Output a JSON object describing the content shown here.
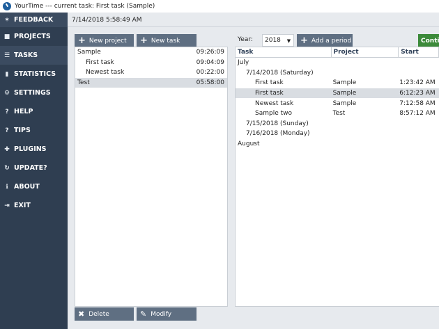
{
  "window": {
    "title": "YourTime --- current task: First task (Sample)"
  },
  "sidebar": {
    "items": [
      {
        "label": "FEEDBACK",
        "icon": "star-icon"
      },
      {
        "label": "PROJECTS",
        "icon": "folder-icon"
      },
      {
        "label": "TASKS",
        "icon": "list-icon"
      },
      {
        "label": "STATISTICS",
        "icon": "bar-chart-icon"
      },
      {
        "label": "SETTINGS",
        "icon": "gear-icon"
      },
      {
        "label": "HELP",
        "icon": "question-icon"
      },
      {
        "label": "TIPS",
        "icon": "question-icon"
      },
      {
        "label": "PLUGINS",
        "icon": "puzzle-icon"
      },
      {
        "label": "UPDATE?",
        "icon": "refresh-icon"
      },
      {
        "label": "ABOUT",
        "icon": "info-icon"
      },
      {
        "label": "EXIT",
        "icon": "exit-icon"
      }
    ]
  },
  "header": {
    "datetime": "7/14/2018 5:58:49 AM"
  },
  "toolbar": {
    "new_project": "New project",
    "new_task": "New task",
    "year_label": "Year:",
    "year_value": "2018",
    "add_period": "Add a period",
    "continue": "Continue"
  },
  "projects": [
    {
      "name": "Sample",
      "time": "09:26:09",
      "level": 0
    },
    {
      "name": "First task",
      "time": "09:04:09",
      "level": 1
    },
    {
      "name": "Newest task",
      "time": "00:22:00",
      "level": 1
    },
    {
      "name": "Test",
      "time": "05:58:00",
      "level": 0
    }
  ],
  "grid": {
    "columns": {
      "task": "Task",
      "project": "Project",
      "start": "Start"
    },
    "rows": [
      {
        "task": "July",
        "project": "",
        "start": "",
        "level": 0
      },
      {
        "task": "7/14/2018 (Saturday)",
        "project": "",
        "start": "",
        "level": 1
      },
      {
        "task": "First task",
        "project": "Sample",
        "start": "1:23:42 AM",
        "level": 2
      },
      {
        "task": "First task",
        "project": "Sample",
        "start": "6:12:23 AM",
        "level": 2
      },
      {
        "task": "Newest task",
        "project": "Sample",
        "start": "7:12:58 AM",
        "level": 2
      },
      {
        "task": "Sample two",
        "project": "Test",
        "start": "8:57:12 AM",
        "level": 2
      },
      {
        "task": "7/15/2018 (Sunday)",
        "project": "",
        "start": "",
        "level": 1
      },
      {
        "task": "7/16/2018 (Monday)",
        "project": "",
        "start": "",
        "level": 1
      },
      {
        "task": "August",
        "project": "",
        "start": "",
        "level": 0
      }
    ]
  },
  "actions": {
    "delete": "Delete",
    "modify": "Modify"
  },
  "colors": {
    "sidebar": "#2f3e51",
    "button": "#5f6f82",
    "continue_button": "#3c8a3a",
    "selection": "#d9dde2"
  }
}
